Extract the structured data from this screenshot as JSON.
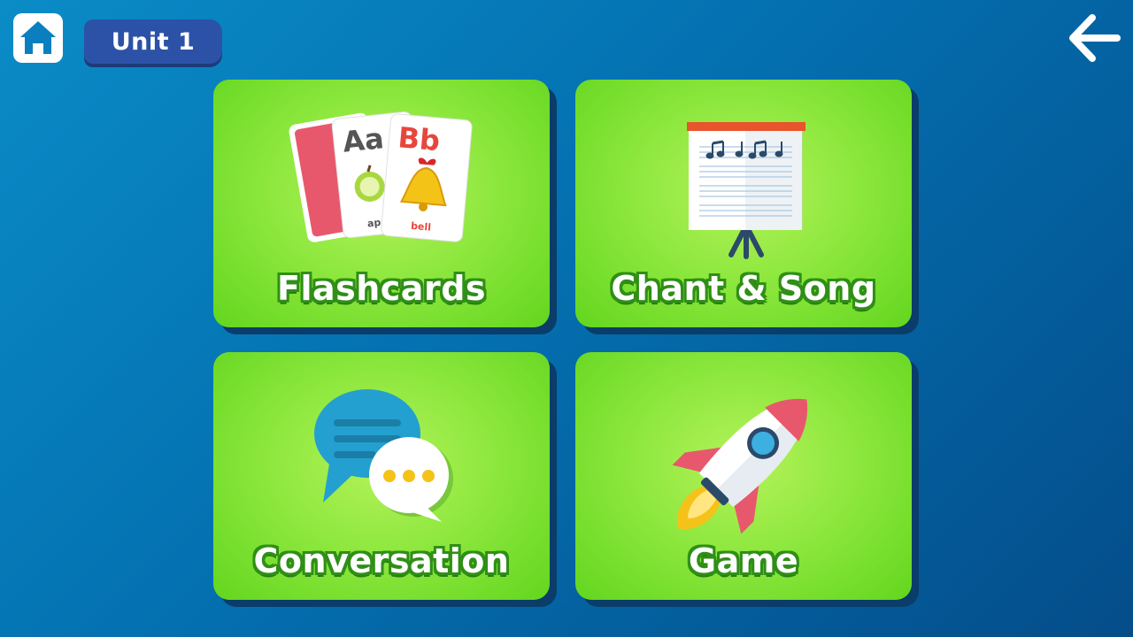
{
  "header": {
    "unit_label": "Unit 1",
    "home_icon": "home-icon",
    "back_icon": "arrow-left-icon"
  },
  "menu": {
    "tiles": [
      {
        "label": "Flashcards",
        "icon": "flashcards-icon",
        "card_front": {
          "letters": "Bb",
          "word": "bell"
        },
        "card_back": {
          "letters": "Aa",
          "word": "ap"
        }
      },
      {
        "label": "Chant & Song",
        "icon": "music-board-icon"
      },
      {
        "label": "Conversation",
        "icon": "speech-bubbles-icon"
      },
      {
        "label": "Game",
        "icon": "rocket-icon"
      }
    ]
  },
  "colors": {
    "background": "#0470b0",
    "tile_green": "#8fe83f",
    "badge_blue": "#2c52a8"
  }
}
